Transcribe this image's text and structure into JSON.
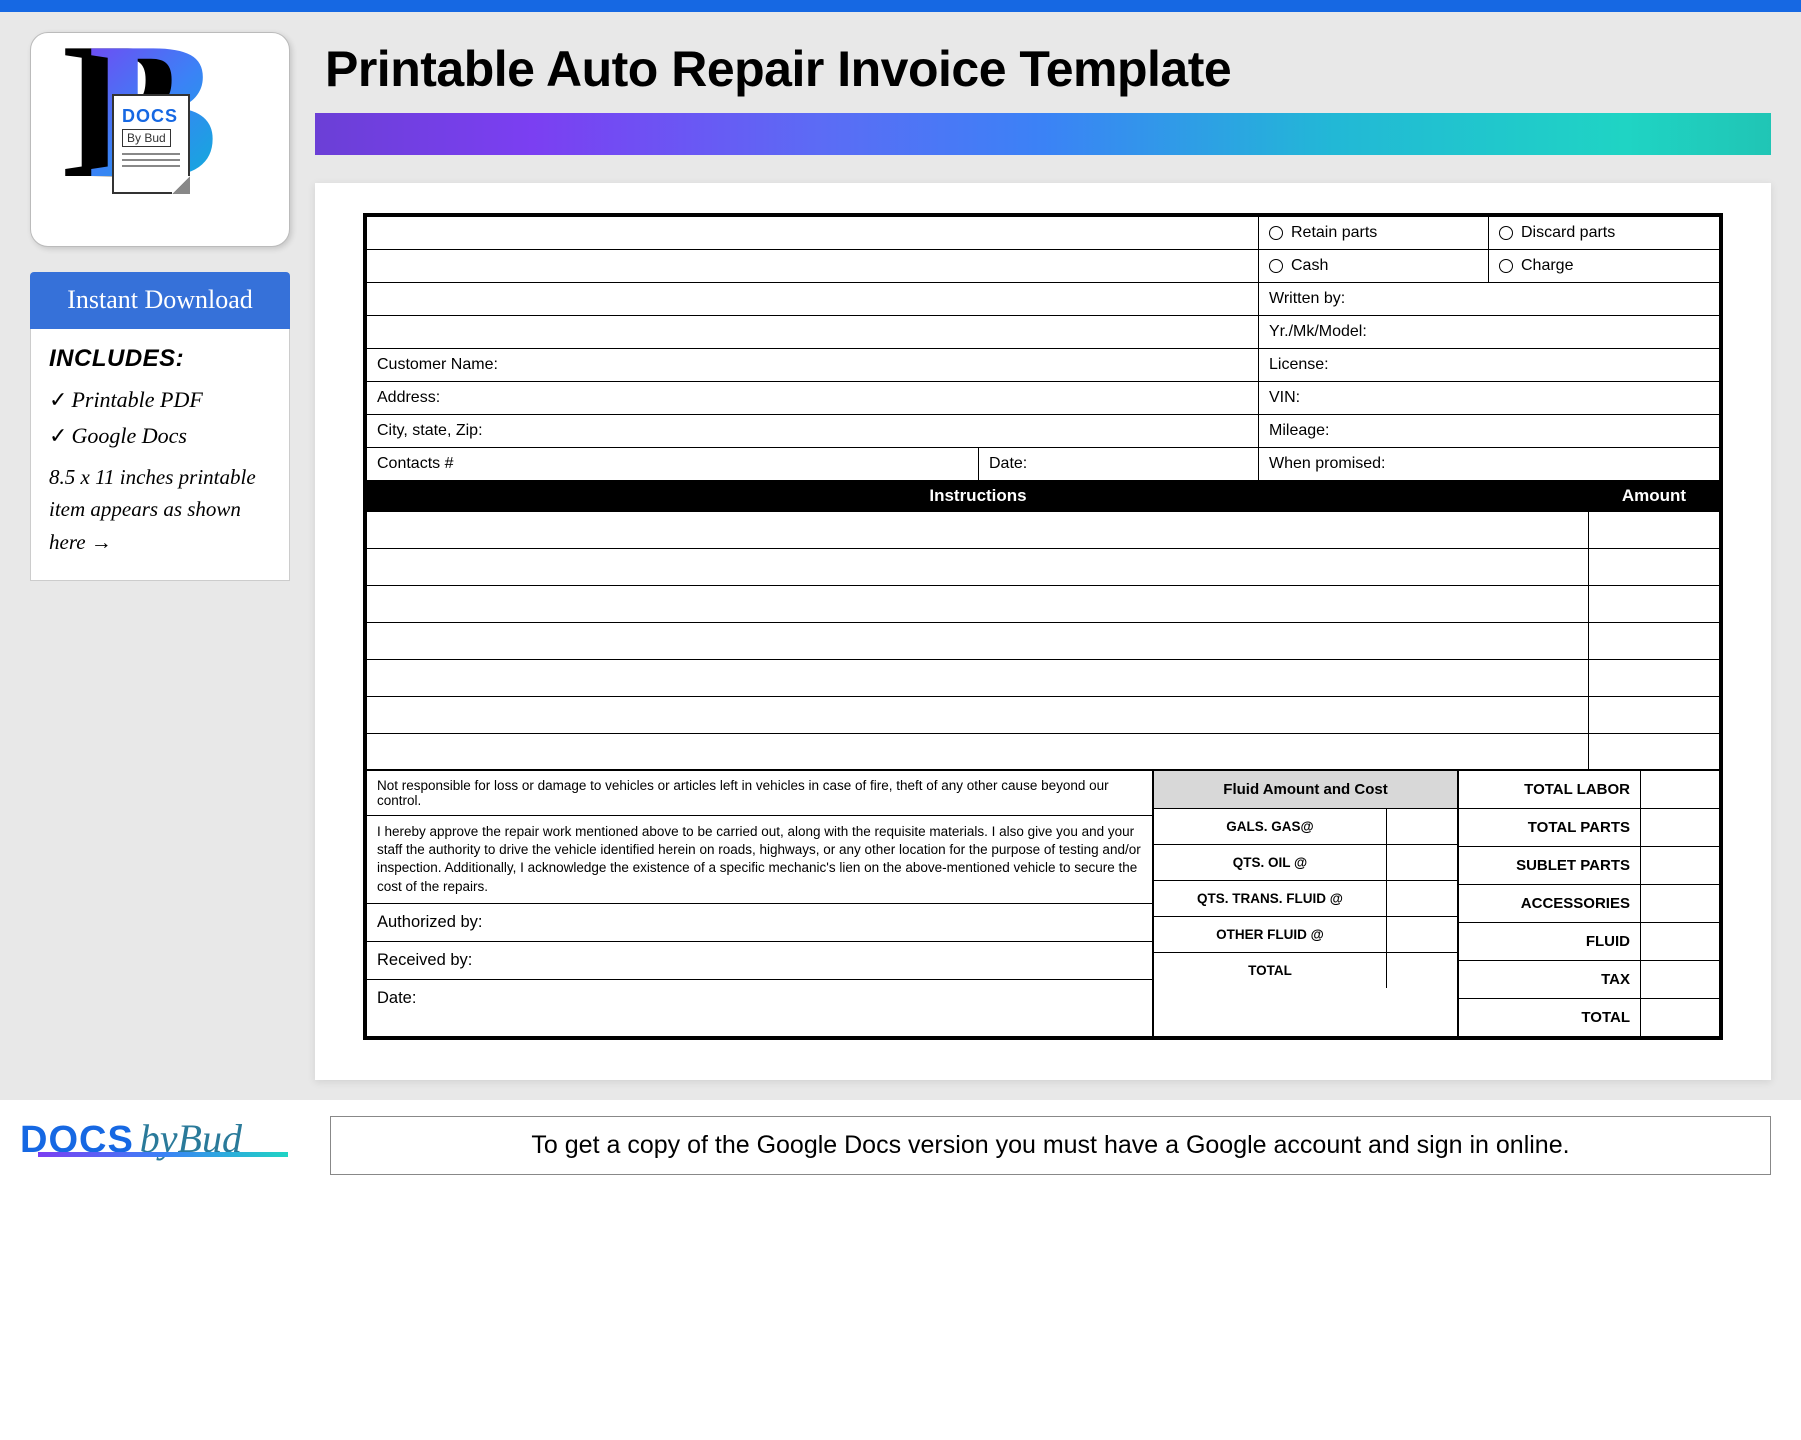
{
  "header": {
    "title": "Printable Auto Repair Invoice Template"
  },
  "logo": {
    "text1": "DOCS",
    "text2": "By Bud"
  },
  "sidebar": {
    "instant": "Instant Download",
    "includes_title": "INCLUDES:",
    "item1": "Printable PDF",
    "item2": "Google Docs",
    "note": "8.5 x 11 inches printable item appears as shown here →"
  },
  "invoice": {
    "retain": "Retain parts",
    "discard": "Discard parts",
    "cash": "Cash",
    "charge": "Charge",
    "written": "Written by:",
    "yrmk": "Yr./Mk/Model:",
    "customer": "Customer Name:",
    "license": "License:",
    "address": "Address:",
    "vin": "VIN:",
    "city": "City, state, Zip:",
    "mileage": "Mileage:",
    "contacts": "Contacts #",
    "date": "Date:",
    "promised": "When promised:",
    "instructions_hdr": "Instructions",
    "amount_hdr": "Amount",
    "disclaimer": "Not responsible for loss or damage to vehicles or articles left in vehicles in case of fire, theft of any other cause beyond our control.",
    "approval": "I hereby approve the repair work mentioned above to be carried out, along with the requisite materials. I also give you and your staff the authority to drive the vehicle identified herein on roads, highways, or any other location for the purpose of testing and/or inspection. Additionally, I acknowledge the existence of a specific mechanic's lien on the above-mentioned vehicle to secure the cost of the repairs.",
    "authorized": "Authorized by:",
    "received": "Received by:",
    "sigdate": "Date:",
    "fluid_hdr": "Fluid Amount and Cost",
    "gas": "GALS. GAS@",
    "oil": "QTS. OIL @",
    "trans": "QTS. TRANS. FLUID @",
    "other": "OTHER FLUID @",
    "fluid_total": "TOTAL",
    "total_labor": "TOTAL LABOR",
    "total_parts": "TOTAL PARTS",
    "sublet": "SUBLET PARTS",
    "accessories": "ACCESSORIES",
    "fluid": "FLUID",
    "tax": "TAX",
    "grand_total": "TOTAL"
  },
  "footer": {
    "docs": "DOCS",
    "bybud": "byBud",
    "note": "To get a copy of the Google Docs version you must have a Google account and sign in online."
  }
}
